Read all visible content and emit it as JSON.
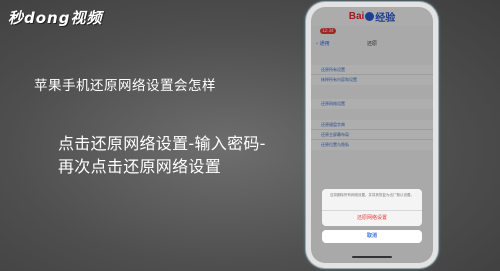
{
  "watermark": {
    "text": "秒dong视频"
  },
  "heading": "苹果手机还原网络设置会怎样",
  "caption": "点击还原网络设置-输入密码-再次点击还原网络设置",
  "app": {
    "logo_left": "Bai",
    "logo_right": "经验",
    "status_time": "12:34",
    "back_label": "‹ 通用",
    "nav_title": "还原"
  },
  "groups": [
    {
      "rows": [
        "还原所有设置",
        "抹掉所有内容和设置"
      ]
    },
    {
      "rows": [
        "还原网络设置"
      ]
    },
    {
      "rows": [
        "还原键盘字典",
        "还原主屏幕布局",
        "还原位置与隐私"
      ]
    }
  ],
  "sheet": {
    "message": "这将删除所有网络设置，并将其恢复为出厂默认设置。",
    "action": "还原网络设置",
    "cancel": "取消"
  },
  "colors": {
    "accent_blue": "#2f6fe0",
    "destructive_red": "#e53935"
  }
}
